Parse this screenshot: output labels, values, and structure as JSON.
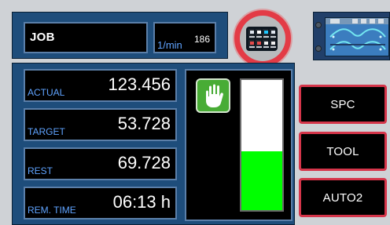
{
  "header": {
    "job_label": "JOB",
    "speed_unit": "1/min",
    "speed_value": "186"
  },
  "metrics": [
    {
      "label": "ACTUAL",
      "value": "123.456"
    },
    {
      "label": "TARGET",
      "value": "53.728"
    },
    {
      "label": "REST",
      "value": "69.728"
    },
    {
      "label": "REM. TIME",
      "value": "06:13 h"
    }
  ],
  "gauge": {
    "level": 0.45,
    "fill_color": "#00ff00",
    "background_color": "#ffffff",
    "icon": "hand-stop-icon"
  },
  "buttons": {
    "spc": "SPC",
    "tool": "TOOL",
    "auto2": "AUTO2"
  },
  "colors": {
    "panel_blue": "#1e4d7b",
    "label_blue": "#5fa3ff",
    "button_border_red": "#d5354a",
    "indicator_red": "#e33b46",
    "status_green": "#48ac35"
  },
  "icons": {
    "status_indicator": "status-indicator-icon",
    "machine_overview": "machine-overview-icon",
    "hand_stop": "hand-stop-icon"
  }
}
